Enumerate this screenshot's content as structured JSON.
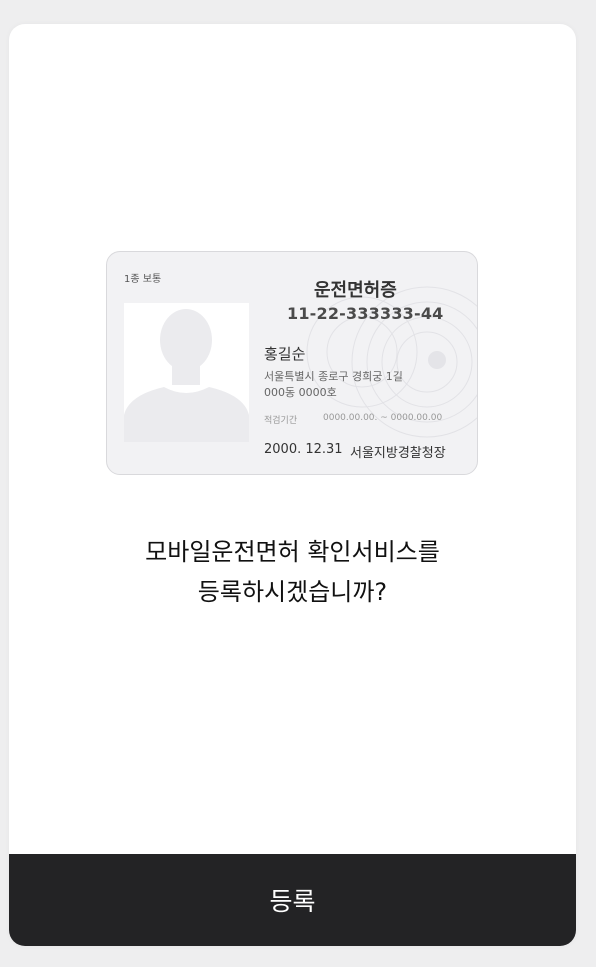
{
  "card": {
    "license_type": "1종 보통",
    "title": "운전면허증",
    "number": "11-22-333333-44",
    "name": "홍길순",
    "address_line1": "서울특별시 종로구 경희궁 1길",
    "address_line2": "000동 0000호",
    "period_label": "적검기간",
    "period_value": "0000.00.00. ~ 0000.00.00",
    "issue_date": "2000. 12.31",
    "issuer": "서울지방경찰청장"
  },
  "dialog": {
    "question_line1": "모바일운전면허 확인서비스를",
    "question_line2": "등록하시겠습니까?"
  },
  "actions": {
    "register_label": "등록"
  },
  "colors": {
    "background": "#eeeeef",
    "modal": "#ffffff",
    "button": "#232325",
    "button_text": "#ffffff"
  }
}
